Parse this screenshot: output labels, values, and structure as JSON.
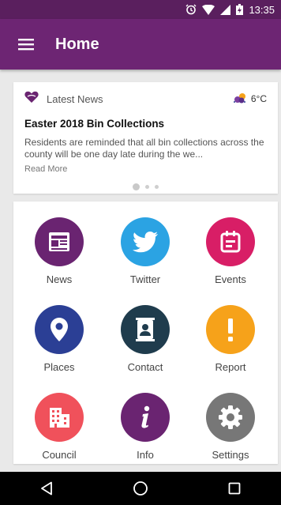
{
  "status_bar": {
    "time": "13:35"
  },
  "app_bar": {
    "title": "Home"
  },
  "news": {
    "label": "Latest News",
    "temperature": "6°C",
    "headline": "Easter 2018 Bin Collections",
    "summary": "Residents are reminded that all bin collections across the county will be one day late during the we...",
    "read_more": "Read More"
  },
  "tiles": [
    {
      "label": "News",
      "color": "#6a2471",
      "icon": "news-icon"
    },
    {
      "label": "Twitter",
      "color": "#2ba3e3",
      "icon": "twitter-icon"
    },
    {
      "label": "Events",
      "color": "#d81e66",
      "icon": "calendar-icon"
    },
    {
      "label": "Places",
      "color": "#2b3f95",
      "icon": "location-pin-icon"
    },
    {
      "label": "Contact",
      "color": "#1f3c4d",
      "icon": "contact-book-icon"
    },
    {
      "label": "Report",
      "color": "#f6a21a",
      "icon": "exclamation-icon"
    },
    {
      "label": "Council",
      "color": "#f0515b",
      "icon": "building-icon"
    },
    {
      "label": "Info",
      "color": "#6a2471",
      "icon": "info-icon"
    },
    {
      "label": "Settings",
      "color": "#777777",
      "icon": "gear-icon"
    }
  ]
}
